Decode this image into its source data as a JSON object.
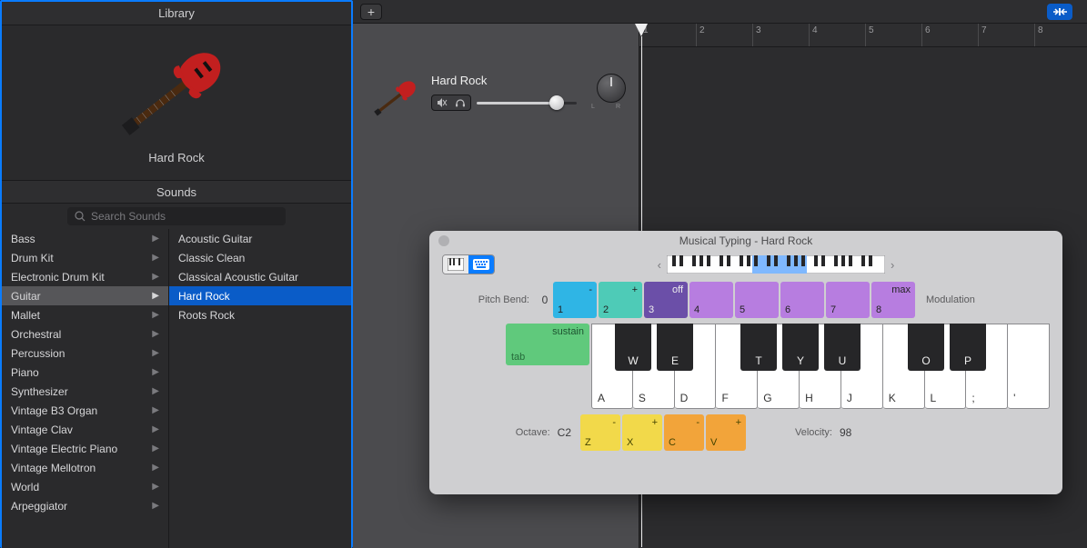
{
  "library": {
    "title": "Library",
    "preview_name": "Hard Rock",
    "sounds_title": "Sounds",
    "search_placeholder": "Search Sounds",
    "categories": [
      {
        "label": "Bass"
      },
      {
        "label": "Drum Kit"
      },
      {
        "label": "Electronic Drum Kit"
      },
      {
        "label": "Guitar",
        "selected": true
      },
      {
        "label": "Mallet"
      },
      {
        "label": "Orchestral"
      },
      {
        "label": "Percussion"
      },
      {
        "label": "Piano"
      },
      {
        "label": "Synthesizer"
      },
      {
        "label": "Vintage B3 Organ"
      },
      {
        "label": "Vintage Clav"
      },
      {
        "label": "Vintage Electric Piano"
      },
      {
        "label": "Vintage Mellotron"
      },
      {
        "label": "World"
      },
      {
        "label": "Arpeggiator"
      }
    ],
    "presets": [
      {
        "label": "Acoustic Guitar"
      },
      {
        "label": "Classic Clean"
      },
      {
        "label": "Classical Acoustic Guitar"
      },
      {
        "label": "Hard Rock",
        "selected": true
      },
      {
        "label": "Roots Rock"
      }
    ]
  },
  "track": {
    "name": "Hard Rock",
    "pan": {
      "l": "L",
      "r": "R"
    },
    "volume_pct": 80
  },
  "ruler": {
    "bars": [
      1,
      2,
      3,
      4,
      5,
      6,
      7,
      8
    ],
    "playhead_bar": 1
  },
  "musical_typing": {
    "title": "Musical Typing - Hard Rock",
    "pitch_bend_label": "Pitch Bend:",
    "pitch_bend_zero": "0",
    "modulation_label": "Modulation",
    "num_keys": [
      {
        "top": "-",
        "bot": "1"
      },
      {
        "top": "+",
        "bot": "2"
      },
      {
        "top": "off",
        "bot": "3"
      },
      {
        "top": "",
        "bot": "4"
      },
      {
        "top": "",
        "bot": "5"
      },
      {
        "top": "",
        "bot": "6"
      },
      {
        "top": "",
        "bot": "7"
      },
      {
        "top": "max",
        "bot": "8"
      }
    ],
    "sustain_top": "sustain",
    "sustain_bot": "tab",
    "white_keys": [
      "A",
      "S",
      "D",
      "F",
      "G",
      "H",
      "J",
      "K",
      "L",
      ";",
      "'"
    ],
    "black_keys": [
      {
        "label": "W",
        "pos": 0
      },
      {
        "label": "E",
        "pos": 1
      },
      {
        "label": "T",
        "pos": 3
      },
      {
        "label": "Y",
        "pos": 4
      },
      {
        "label": "U",
        "pos": 5
      },
      {
        "label": "O",
        "pos": 7
      },
      {
        "label": "P",
        "pos": 8
      }
    ],
    "octave_label": "Octave:",
    "octave_value": "C2",
    "fn_keys": [
      {
        "top": "-",
        "bot": "Z",
        "cls": "fn-z"
      },
      {
        "top": "+",
        "bot": "X",
        "cls": "fn-x"
      },
      {
        "top": "-",
        "bot": "C",
        "cls": "fn-c"
      },
      {
        "top": "+",
        "bot": "V",
        "cls": "fn-v"
      }
    ],
    "velocity_label": "Velocity:",
    "velocity_value": "98"
  }
}
